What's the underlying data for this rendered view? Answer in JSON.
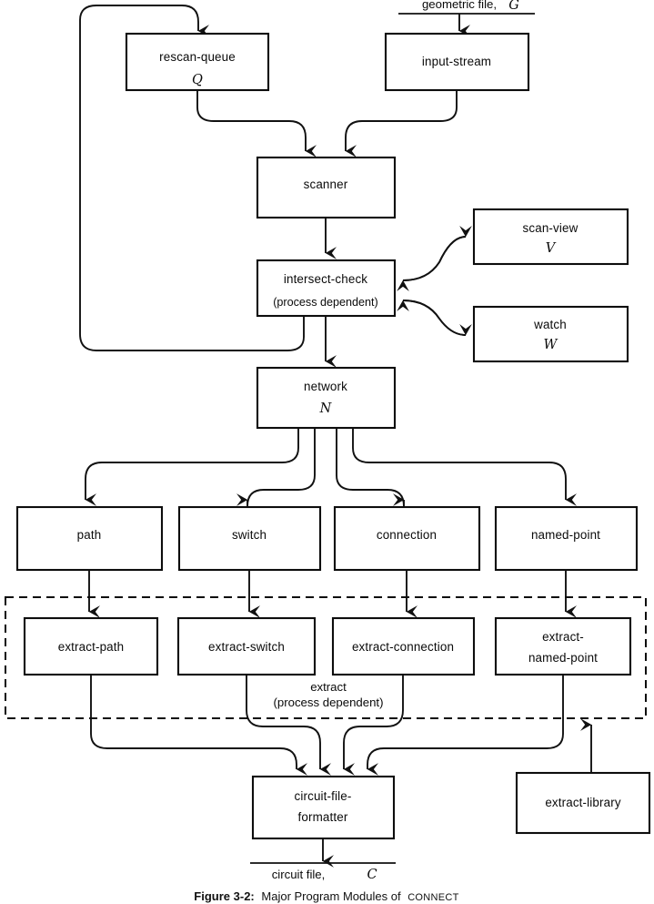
{
  "figure": {
    "caption_prefix": "Figure 3-2:",
    "caption_main": "Major Program Modules of",
    "caption_smallcaps": "CONNECT"
  },
  "io": {
    "input_label": "geometric file,",
    "input_symbol": "G",
    "output_label": "circuit file,",
    "output_symbol": "C"
  },
  "nodes": {
    "rescan_queue": {
      "label": "rescan-queue",
      "symbol": "Q"
    },
    "input_stream": {
      "label": "input-stream",
      "symbol": ""
    },
    "scanner": {
      "label": "scanner",
      "symbol": ""
    },
    "intersect_check": {
      "label": "intersect-check",
      "sublabel": "(process dependent)"
    },
    "scan_view": {
      "label": "scan-view",
      "symbol": "V"
    },
    "watch": {
      "label": "watch",
      "symbol": "W"
    },
    "network": {
      "label": "network",
      "symbol": "N"
    },
    "path": {
      "label": "path"
    },
    "switch": {
      "label": "switch"
    },
    "connection": {
      "label": "connection"
    },
    "named_point": {
      "label": "named-point"
    },
    "extract_path": {
      "label": "extract-path"
    },
    "extract_switch": {
      "label": "extract-switch"
    },
    "extract_connection": {
      "label": "extract-connection"
    },
    "extract_named_point": {
      "label_line1": "extract-",
      "label_line2": "named-point"
    },
    "circuit_file_formatter": {
      "label_line1": "circuit-file-",
      "label_line2": "formatter"
    },
    "extract_library": {
      "label": "extract-library"
    }
  },
  "groups": {
    "extract": {
      "label": "extract",
      "sublabel": "(process dependent)"
    }
  },
  "colors": {
    "stroke": "#111111",
    "box_fill": "#ffffff",
    "page_bg": "#ffffff"
  }
}
